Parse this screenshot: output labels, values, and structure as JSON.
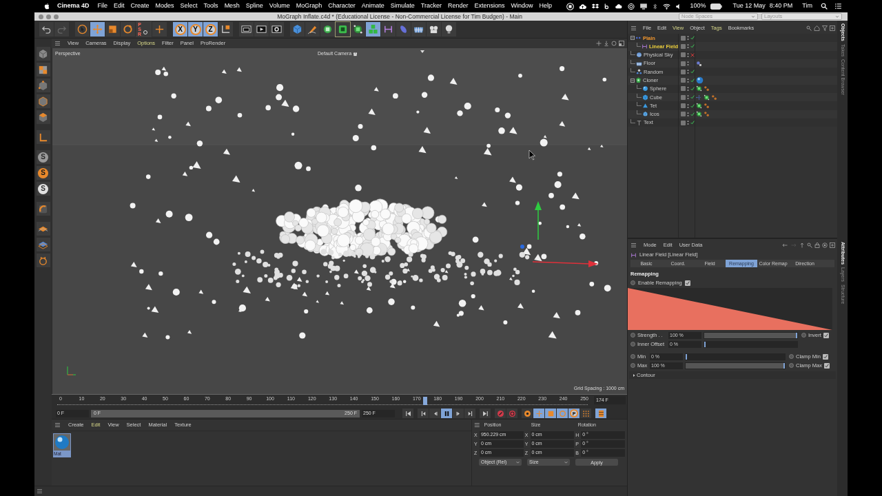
{
  "menubar": {
    "app": "Cinema 4D",
    "menus": [
      "File",
      "Edit",
      "Create",
      "Modes",
      "Select",
      "Tools",
      "Mesh",
      "Spline",
      "Volume",
      "MoGraph",
      "Character",
      "Animate",
      "Simulate",
      "Tracker",
      "Render",
      "Extensions",
      "Window",
      "Help"
    ],
    "battery": "100%",
    "date": "Tue 12 May",
    "time": "8:40 PM",
    "user": "Tim"
  },
  "window": {
    "title": "MoGraph Inflate.c4d * (Educational License - Non-Commercial License for Tim Budgen) - Main",
    "node_spaces": "Node Spaces",
    "layouts": "Layouts"
  },
  "toolbar": [
    {
      "kind": "undo",
      "selected": false
    },
    {
      "kind": "redo",
      "selected": false
    },
    {
      "kind": "select",
      "selected": false
    },
    {
      "kind": "move",
      "selected": true
    },
    {
      "kind": "scale",
      "selected": false
    },
    {
      "kind": "rotate",
      "selected": false
    },
    {
      "kind": "psr",
      "label": "PSR",
      "selected": false
    },
    {
      "kind": "axis",
      "selected": false
    },
    {
      "kind": "axis-lock",
      "label": "X",
      "selected": true
    },
    {
      "kind": "axis-lock",
      "label": "Y",
      "selected": true
    },
    {
      "kind": "axis-lock",
      "label": "Z",
      "selected": true
    },
    {
      "kind": "coord",
      "selected": false
    },
    {
      "kind": "render-region",
      "selected": false
    },
    {
      "kind": "render-view",
      "selected": false
    },
    {
      "kind": "render-settings",
      "selected": false
    },
    {
      "kind": "cube",
      "selected": false
    },
    {
      "kind": "pen",
      "selected": false
    },
    {
      "kind": "subdivide",
      "selected": false
    },
    {
      "kind": "extrude",
      "selected": true
    },
    {
      "kind": "mograph",
      "selected": false
    },
    {
      "kind": "cloner",
      "selected": true
    },
    {
      "kind": "deformer",
      "selected": false
    },
    {
      "kind": "field",
      "selected": false
    },
    {
      "kind": "floor",
      "selected": false
    },
    {
      "kind": "camera",
      "selected": false
    },
    {
      "kind": "light",
      "selected": false
    }
  ],
  "left_tools": [
    {
      "kind": "model"
    },
    {
      "kind": "texture"
    },
    {
      "kind": "points"
    },
    {
      "kind": "edges"
    },
    {
      "kind": "polygons"
    },
    {
      "kind": "axis-l"
    },
    {
      "kind": "snap-gray",
      "label": "S"
    },
    {
      "kind": "snap-orange",
      "label": "S"
    },
    {
      "kind": "snap-white",
      "label": "S"
    },
    {
      "kind": "magnet"
    },
    {
      "kind": "workplane"
    },
    {
      "kind": "grid"
    },
    {
      "kind": "lock"
    }
  ],
  "viewport": {
    "menus": [
      {
        "label": "View",
        "highlighted": false
      },
      {
        "label": "Cameras",
        "highlighted": false
      },
      {
        "label": "Display",
        "highlighted": false
      },
      {
        "label": "Options",
        "highlighted": true
      },
      {
        "label": "Filter",
        "highlighted": false
      },
      {
        "label": "Panel",
        "highlighted": false
      },
      {
        "label": "ProRender",
        "highlighted": false
      }
    ],
    "view_name": "Perspective",
    "camera": "Default Camera",
    "grid_spacing": "Grid Spacing : 1000 cm"
  },
  "timeline": {
    "ticks": [
      "0",
      "10",
      "20",
      "30",
      "40",
      "50",
      "60",
      "70",
      "80",
      "90",
      "100",
      "110",
      "120",
      "130",
      "140",
      "150",
      "160",
      "170",
      "180",
      "190",
      "200",
      "210",
      "220",
      "230",
      "240",
      "250"
    ],
    "playhead": {
      "level": 0.696
    },
    "current_frame": "174 F",
    "start": "0 F",
    "range_start": "0 F",
    "range_end": "250 F",
    "end": "250 F"
  },
  "transport": [
    {
      "kind": "first",
      "selected": false
    },
    {
      "kind": "prev-key",
      "selected": false
    },
    {
      "kind": "prev-frame",
      "selected": false
    },
    {
      "kind": "pause",
      "selected": true
    },
    {
      "kind": "next-frame",
      "selected": false
    },
    {
      "kind": "next-key",
      "selected": false
    },
    {
      "kind": "last",
      "selected": false
    },
    {
      "kind": "record",
      "selected": false
    },
    {
      "kind": "autokey",
      "selected": false
    },
    {
      "kind": "key-selection",
      "selected": false
    },
    {
      "kind": "key-move",
      "selected": true
    },
    {
      "kind": "key-scale",
      "selected": true
    },
    {
      "kind": "key-rotate",
      "selected": true
    },
    {
      "kind": "key-param",
      "label": "P",
      "selected": true
    },
    {
      "kind": "key-pla",
      "selected": false
    },
    {
      "kind": "timeline",
      "selected": true
    }
  ],
  "material_manager": {
    "menus": [
      {
        "label": "Create",
        "highlighted": false
      },
      {
        "label": "Edit",
        "highlighted": true
      },
      {
        "label": "View",
        "highlighted": false
      },
      {
        "label": "Select",
        "highlighted": false
      },
      {
        "label": "Material",
        "highlighted": false
      },
      {
        "label": "Texture",
        "highlighted": false
      }
    ],
    "materials": [
      {
        "name": "Mat",
        "selected": true
      }
    ]
  },
  "coordinates": {
    "headers": [
      "Position",
      "Size",
      "Rotation"
    ],
    "rows": [
      [
        {
          "axis": "X",
          "value": "950.229 cm"
        },
        {
          "axis": "X",
          "value": "0 cm"
        },
        {
          "axis": "H",
          "value": "0 °"
        }
      ],
      [
        {
          "axis": "Y",
          "value": "0 cm"
        },
        {
          "axis": "Y",
          "value": "0 cm"
        },
        {
          "axis": "P",
          "value": "0 °"
        }
      ],
      [
        {
          "axis": "Z",
          "value": "0 cm"
        },
        {
          "axis": "Z",
          "value": "0 cm"
        },
        {
          "axis": "B",
          "value": "0 °"
        }
      ]
    ],
    "mode": "Object (Rel)",
    "size_mode": "Size",
    "apply": "Apply"
  },
  "object_manager": {
    "menus": [
      {
        "label": "File",
        "highlighted": false
      },
      {
        "label": "Edit",
        "highlighted": false
      },
      {
        "label": "View",
        "highlighted": true
      },
      {
        "label": "Object",
        "highlighted": false
      },
      {
        "label": "Tags",
        "highlighted": true
      },
      {
        "label": "Bookmarks",
        "highlighted": false
      }
    ],
    "objects": [
      {
        "name": "Plain",
        "kind": "plain",
        "selected": true,
        "active": false,
        "toggle": {
          "kind": "check"
        },
        "expanded": true,
        "children": [
          {
            "name": "Linear Field",
            "kind": "linear-field",
            "selected": true,
            "active": true,
            "toggle": {
              "kind": "check"
            }
          }
        ]
      },
      {
        "name": "Physical Sky",
        "kind": "sky",
        "selected": false,
        "active": false,
        "toggle": {
          "kind": "cross"
        }
      },
      {
        "name": "Floor",
        "kind": "floor",
        "selected": false,
        "active": false,
        "tags": [
          {
            "kind": "texture-small"
          }
        ]
      },
      {
        "name": "Random",
        "kind": "random",
        "selected": false,
        "active": false,
        "toggle": {
          "kind": "check"
        }
      },
      {
        "name": "Cloner",
        "kind": "cloner",
        "selected": false,
        "active": false,
        "toggle": {
          "kind": "check"
        },
        "tags": [
          {
            "kind": "material"
          }
        ],
        "expanded": true,
        "children": [
          {
            "name": "Sphere",
            "kind": "sphere",
            "selected": false,
            "active": false,
            "toggle": {
              "kind": "check"
            },
            "tags": [
              {
                "kind": "mograph"
              },
              {
                "kind": "color"
              }
            ]
          },
          {
            "name": "Cube",
            "kind": "cube",
            "selected": false,
            "active": false,
            "toggle": {
              "kind": "check"
            },
            "tags": [
              {
                "kind": "dots"
              },
              {
                "kind": "mograph"
              },
              {
                "kind": "color"
              }
            ]
          },
          {
            "name": "Tet",
            "kind": "tet",
            "selected": false,
            "active": false,
            "toggle": {
              "kind": "check"
            },
            "tags": [
              {
                "kind": "mograph"
              },
              {
                "kind": "color"
              }
            ]
          },
          {
            "name": "Icos",
            "kind": "icos",
            "selected": false,
            "active": false,
            "toggle": {
              "kind": "check"
            },
            "tags": [
              {
                "kind": "mograph"
              },
              {
                "kind": "color"
              }
            ]
          }
        ]
      },
      {
        "name": "Text",
        "kind": "text",
        "selected": false,
        "active": false,
        "toggle": {
          "kind": "check"
        }
      }
    ]
  },
  "side_tabs_top": [
    {
      "label": "Objects",
      "selected": true
    },
    {
      "label": "Takes",
      "selected": false
    },
    {
      "label": "Content Browser",
      "selected": false
    }
  ],
  "side_tabs_bottom": [
    {
      "label": "Attributes",
      "selected": true
    },
    {
      "label": "Layers",
      "selected": false
    },
    {
      "label": "Structure",
      "selected": false
    }
  ],
  "attributes": {
    "menus": [
      "Mode",
      "Edit",
      "User Data"
    ],
    "title": "Linear Field [Linear Field]",
    "tabs": [
      {
        "label": "Basic",
        "selected": false
      },
      {
        "label": "Coord.",
        "selected": false
      },
      {
        "label": "Field",
        "selected": false
      },
      {
        "label": "Remapping",
        "selected": true
      },
      {
        "label": "Color Remap",
        "selected": false
      },
      {
        "label": "Direction",
        "selected": false
      }
    ],
    "section": "Remapping",
    "enable_remapping": {
      "label": "Enable Remapping",
      "checked": true
    },
    "param_groups": [
      [
        {
          "label": "Strength . .",
          "value": "100 %",
          "level": 1,
          "toggle": {
            "label": "Invert",
            "checked": true
          }
        },
        {
          "label": "Inner Offset",
          "value": "0 %",
          "level": 0
        }
      ],
      [
        {
          "label": "Min",
          "value": "0 %",
          "level": 0,
          "toggle": {
            "label": "Clamp Min",
            "checked": true
          }
        },
        {
          "label": "Max",
          "value": "100 %",
          "level": 1,
          "toggle": {
            "label": "Clamp Max",
            "checked": true
          }
        }
      ]
    ],
    "contour": {
      "label": "Contour",
      "expanded": false
    }
  }
}
